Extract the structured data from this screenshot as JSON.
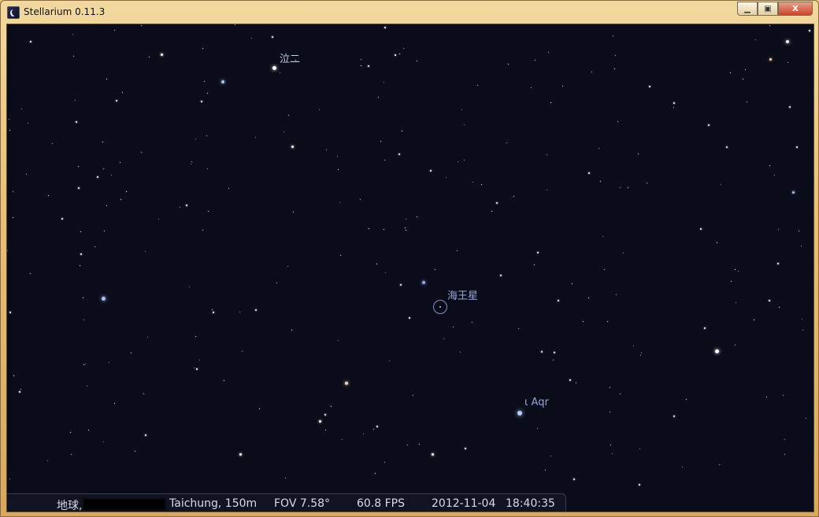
{
  "window": {
    "title": "Stellarium 0.11.3",
    "icon": "stellarium-app-icon",
    "controls": [
      "minimize-icon",
      "maximize-icon",
      "close-icon"
    ]
  },
  "sky": {
    "labels": {
      "star1": "泣二",
      "planet": "海王星",
      "star2": "ι Aqr"
    }
  },
  "status": {
    "location": "地球,",
    "city": "Taichung, 150m",
    "fov": "FOV 7.58°",
    "fps": "60.8 FPS",
    "date": "2012-11-04",
    "time": "18:40:35"
  }
}
